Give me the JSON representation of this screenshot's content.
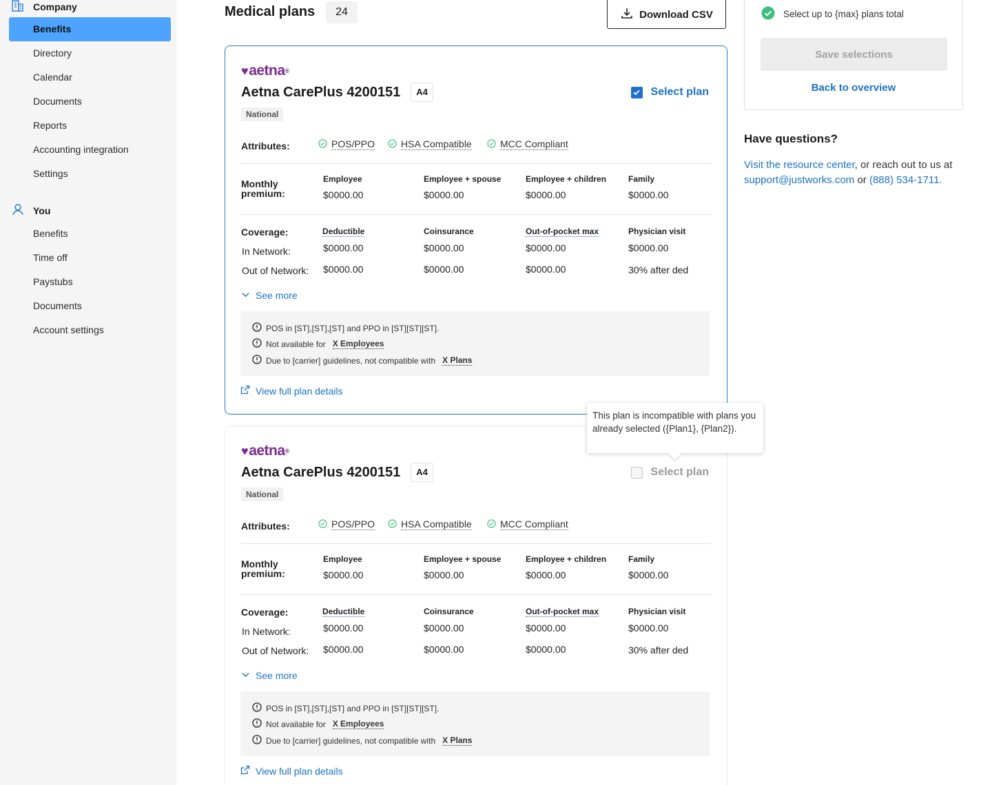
{
  "sidebar": {
    "company": {
      "heading": "Company",
      "items": [
        "Benefits",
        "Directory",
        "Calendar",
        "Documents",
        "Reports",
        "Accounting integration",
        "Settings"
      ],
      "active_index": 0
    },
    "you": {
      "heading": "You",
      "items": [
        "Benefits",
        "Time off",
        "Paystubs",
        "Documents",
        "Account settings"
      ]
    }
  },
  "header": {
    "title": "Medical plans",
    "count": "24",
    "download_label": "Download CSV"
  },
  "plans": [
    {
      "carrier_logo": "aetna",
      "name": "Aetna CarePlus 4200151",
      "tier": "A4",
      "region": "National",
      "selected": true,
      "select_label": "Select plan",
      "attributes_label": "Attributes:",
      "attributes": [
        "POS/PPO",
        "HSA Compatible",
        "MCC Compliant"
      ],
      "premium_label_1": "Monthly",
      "premium_label_2": "premium:",
      "premium_headers": [
        "Employee",
        "Employee + spouse",
        "Employee + children",
        "Family"
      ],
      "premium_values": [
        "$0000.00",
        "$0000.00",
        "$0000.00",
        "$0000.00"
      ],
      "coverage_label": "Coverage:",
      "coverage_headers": [
        "Deductible",
        "Coinsurance",
        "Out-of-pocket max",
        "Physician visit"
      ],
      "in_network_label": "In Network:",
      "in_network": [
        "$0000.00",
        "$0000.00",
        "$0000.00",
        "$0000.00"
      ],
      "out_network_label": "Out of Network:",
      "out_network": [
        "$0000.00",
        "$0000.00",
        "$0000.00",
        "30% after ded"
      ],
      "see_more": "See more",
      "notes": [
        {
          "text": "POS in [ST],[ST],[ST] and PPO in [ST][ST][ST].",
          "link": ""
        },
        {
          "text": "Not available for",
          "link": "X Employees"
        },
        {
          "text": "Due to [carrier] guidelines, not compatible with",
          "link": "X Plans"
        }
      ],
      "view_details": "View full plan details"
    },
    {
      "carrier_logo": "aetna",
      "name": "Aetna CarePlus 4200151",
      "tier": "A4",
      "region": "National",
      "selected": false,
      "select_label": "Select plan",
      "attributes_label": "Attributes:",
      "attributes": [
        "POS/PPO",
        "HSA Compatible",
        "MCC Compliant"
      ],
      "premium_label_1": "Monthly",
      "premium_label_2": "premium:",
      "premium_headers": [
        "Employee",
        "Employee + spouse",
        "Employee + children",
        "Family"
      ],
      "premium_values": [
        "$0000.00",
        "$0000.00",
        "$0000.00",
        "$0000.00"
      ],
      "coverage_label": "Coverage:",
      "coverage_headers": [
        "Deductible",
        "Coinsurance",
        "Out-of-pocket max",
        "Physician visit"
      ],
      "in_network_label": "In Network:",
      "in_network": [
        "$0000.00",
        "$0000.00",
        "$0000.00",
        "$0000.00"
      ],
      "out_network_label": "Out of Network:",
      "out_network": [
        "$0000.00",
        "$0000.00",
        "$0000.00",
        "30% after ded"
      ],
      "see_more": "See more",
      "notes": [
        {
          "text": "POS in [ST],[ST],[ST] and PPO in [ST][ST][ST].",
          "link": ""
        },
        {
          "text": "Not available for",
          "link": "X Employees"
        },
        {
          "text": "Due to [carrier] guidelines, not compatible with",
          "link": "X Plans"
        }
      ],
      "view_details": "View full plan details"
    }
  ],
  "tooltip": {
    "text": "This plan is incompatible with plans you already selected ({Plan1}, {Plan2})."
  },
  "panel": {
    "requirement": "Select up to {max} plans total",
    "save_label": "Save selections",
    "back_label": "Back to overview"
  },
  "questions": {
    "title": "Have questions?",
    "resource_link": "Visit the resource center",
    "middle_text": ", or reach out to us at ",
    "email": "support@justworks.com",
    "or_text": " or ",
    "phone": "(888) 534-1711."
  },
  "colors": {
    "accent": "#1a73c7",
    "active_nav": "#4da3ff",
    "carrier_brand": "#7b2a8e",
    "success": "#3dbf7a"
  }
}
